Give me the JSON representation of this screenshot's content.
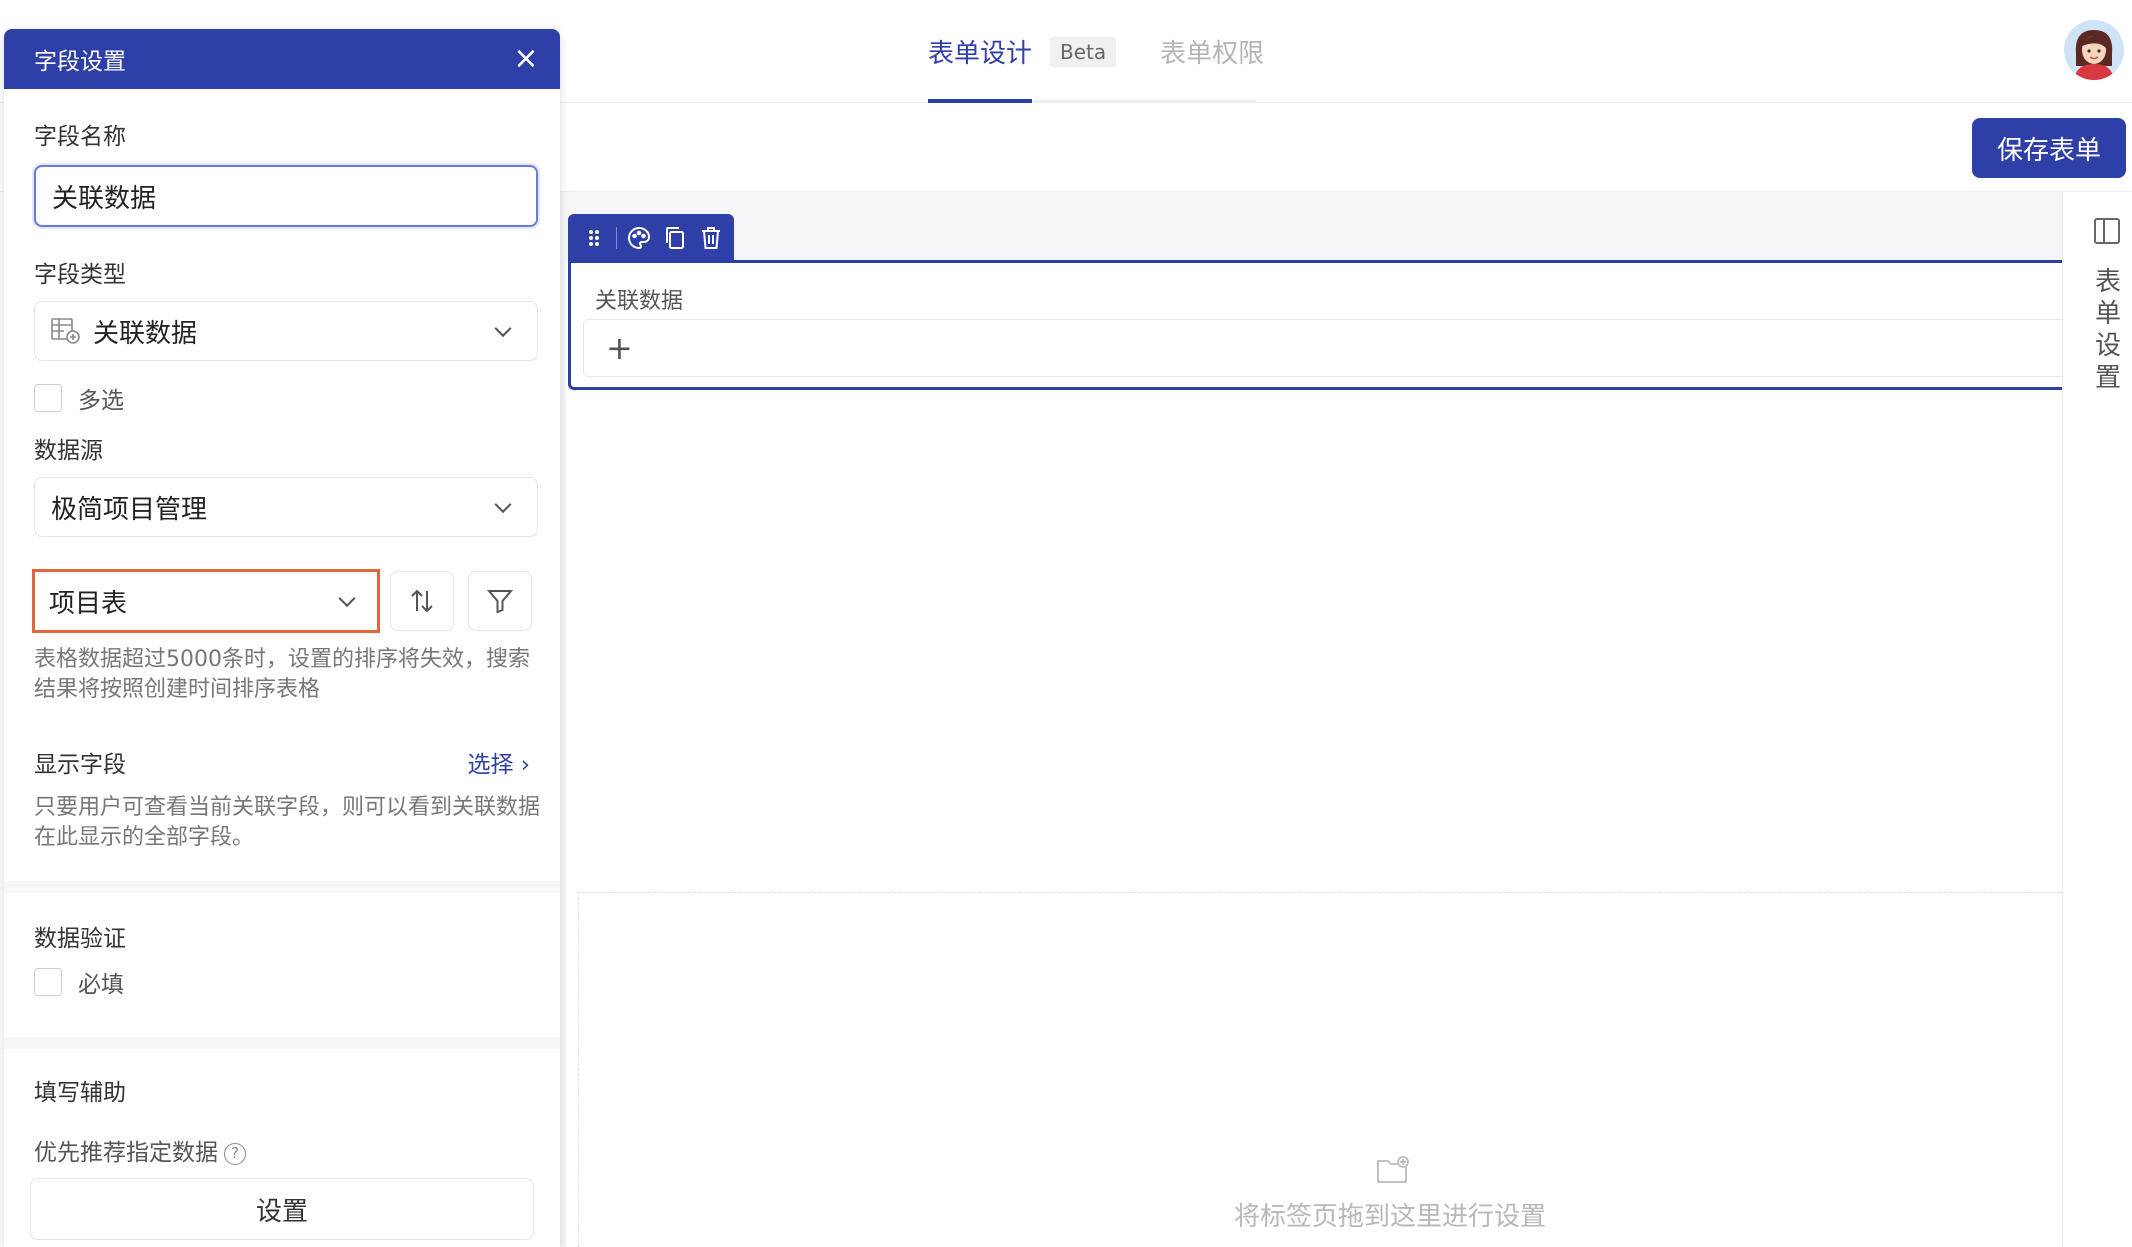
{
  "header": {
    "tabs": [
      {
        "label": "表单设计",
        "active": true
      },
      {
        "label": "表单权限",
        "active": false
      }
    ],
    "beta_badge": "Beta",
    "save_label": "保存表单"
  },
  "panel": {
    "title": "字段设置",
    "field_name_label": "字段名称",
    "field_name_value": "关联数据",
    "field_type_label": "字段类型",
    "field_type_value": "关联数据",
    "multi_select_label": "多选",
    "datasource_label": "数据源",
    "datasource_app": "极简项目管理",
    "datasource_table": "项目表",
    "datasource_help": "表格数据超过5000条时，设置的排序将失效，搜索结果将按照创建时间排序表格",
    "display_fields_label": "显示字段",
    "display_fields_link": "选择",
    "display_fields_help": "只要用户可查看当前关联字段，则可以看到关联数据在此显示的全部字段。",
    "validation_label": "数据验证",
    "required_label": "必填",
    "assist_label": "填写辅助",
    "recommend_label": "优先推荐指定数据",
    "settings_button": "设置"
  },
  "canvas": {
    "field_label": "关联数据",
    "drop_hint": "将标签页拖到这里进行设置"
  },
  "rail": {
    "label": "表单设置"
  },
  "colors": {
    "primary": "#2f3fa8",
    "highlight_border": "#e0663c"
  }
}
